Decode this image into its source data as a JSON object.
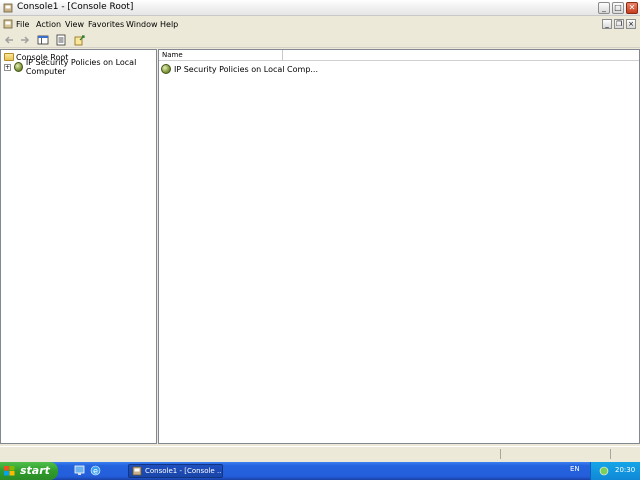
{
  "window": {
    "title": "Console1 - [Console Root]",
    "buttons": {
      "minimize": "_",
      "maximize": "□",
      "close": "✕"
    }
  },
  "menubar": {
    "items": [
      {
        "label": "File"
      },
      {
        "label": "Action"
      },
      {
        "label": "View"
      },
      {
        "label": "Favorites"
      },
      {
        "label": "Window"
      },
      {
        "label": "Help"
      }
    ]
  },
  "toolbar": {
    "icons": [
      "back-arrow-icon",
      "forward-arrow-icon",
      "show-hide-tree-icon",
      "properties-icon",
      "export-list-icon"
    ]
  },
  "tree": {
    "root_label": "Console Root",
    "children": [
      {
        "label": "IP Security Policies on Local Computer",
        "expander": "+"
      }
    ]
  },
  "list": {
    "columns": [
      {
        "label": "Name"
      }
    ],
    "rows": [
      {
        "name": "IP Security Policies on Local Comp..."
      }
    ]
  },
  "taskbar": {
    "start_label": "start",
    "task_button_label": "Console1 - [Console ...",
    "language": "EN",
    "clock": "20:30"
  },
  "colors": {
    "taskbar_blue": "#245edb",
    "start_green": "#2f9c2b",
    "tray_blue": "#0f88d5"
  }
}
